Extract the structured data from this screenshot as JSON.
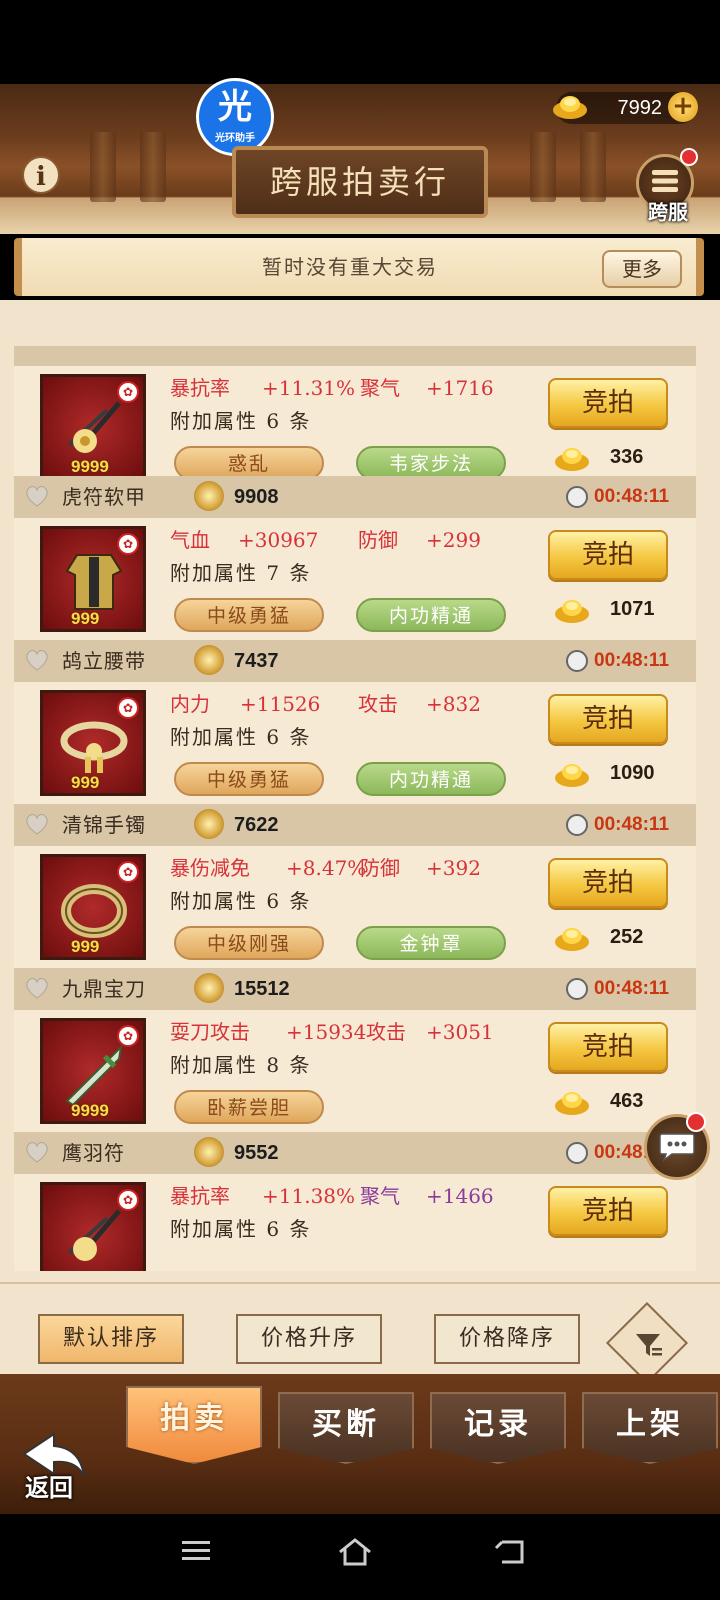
{
  "app": {
    "title": "跨服拍卖行",
    "cross_label": "跨服",
    "gold": "7992",
    "logo_big": "光",
    "logo_small": "光环助手",
    "info": "i"
  },
  "notice": {
    "text": "暂时没有重大交易",
    "more": "更多"
  },
  "items": [
    {
      "stat1": "暴抗率",
      "val1": "+11.31%",
      "stat2": "聚气",
      "val2": "+1716",
      "stat2_color": "#d7323a",
      "extra": "附加属性 6 条",
      "tags": [
        {
          "text": "惑乱",
          "color": "orange"
        },
        {
          "text": "韦家步法",
          "color": "green"
        }
      ],
      "count": "9999",
      "price": "336",
      "bid": "竞拍",
      "icon": "pin-icon"
    },
    {
      "name": "虎符软甲",
      "power": "9908",
      "timer": "00:48:11",
      "stat1": "气血",
      "val1": "+30967",
      "stat2": "防御",
      "val2": "+299",
      "extra": "附加属性 7 条",
      "tags": [
        {
          "text": "中级勇猛",
          "color": "orange"
        },
        {
          "text": "内功精通",
          "color": "green"
        }
      ],
      "count": "999",
      "price": "1071",
      "bid": "竞拍",
      "icon": "armor-icon"
    },
    {
      "name": "鸪立腰带",
      "power": "7437",
      "timer": "00:48:11",
      "stat1": "内力",
      "val1": "+11526",
      "stat2": "攻击",
      "val2": "+832",
      "extra": "附加属性 6 条",
      "tags": [
        {
          "text": "中级勇猛",
          "color": "orange"
        },
        {
          "text": "内功精通",
          "color": "green"
        }
      ],
      "count": "999",
      "price": "1090",
      "bid": "竞拍",
      "icon": "belt-icon"
    },
    {
      "name": "清锦手镯",
      "power": "7622",
      "timer": "00:48:11",
      "stat1": "暴伤减免",
      "val1": "+8.47%",
      "stat2": "防御",
      "val2": "+392",
      "extra": "附加属性 6 条",
      "tags": [
        {
          "text": "中级刚强",
          "color": "orange"
        },
        {
          "text": "金钟罩",
          "color": "green"
        }
      ],
      "count": "999",
      "price": "252",
      "bid": "竞拍",
      "icon": "bracelet-icon"
    },
    {
      "name": "九鼎宝刀",
      "power": "15512",
      "timer": "00:48:11",
      "stat1": "耍刀攻击",
      "val1": "+15934",
      "stat2": "攻击",
      "val2": "+3051",
      "extra": "附加属性 8 条",
      "tags": [
        {
          "text": "卧薪尝胆",
          "color": "orange"
        }
      ],
      "count": "9999",
      "price": "463",
      "bid": "竞拍",
      "icon": "sword-icon"
    },
    {
      "name": "鹰羽符",
      "power": "9552",
      "timer": "00:48:11",
      "stat1": "暴抗率",
      "val1": "+11.38%",
      "stat2": "聚气",
      "val2": "+1466",
      "extra": "附加属性 6 条",
      "bid": "竞拍",
      "icon": "pin-icon"
    }
  ],
  "sort": {
    "default": "默认排序",
    "asc": "价格升序",
    "desc": "价格降序"
  },
  "tabs": {
    "auction": "拍卖",
    "buyout": "买断",
    "record": "记录",
    "list": "上架"
  },
  "back_label": "返回"
}
